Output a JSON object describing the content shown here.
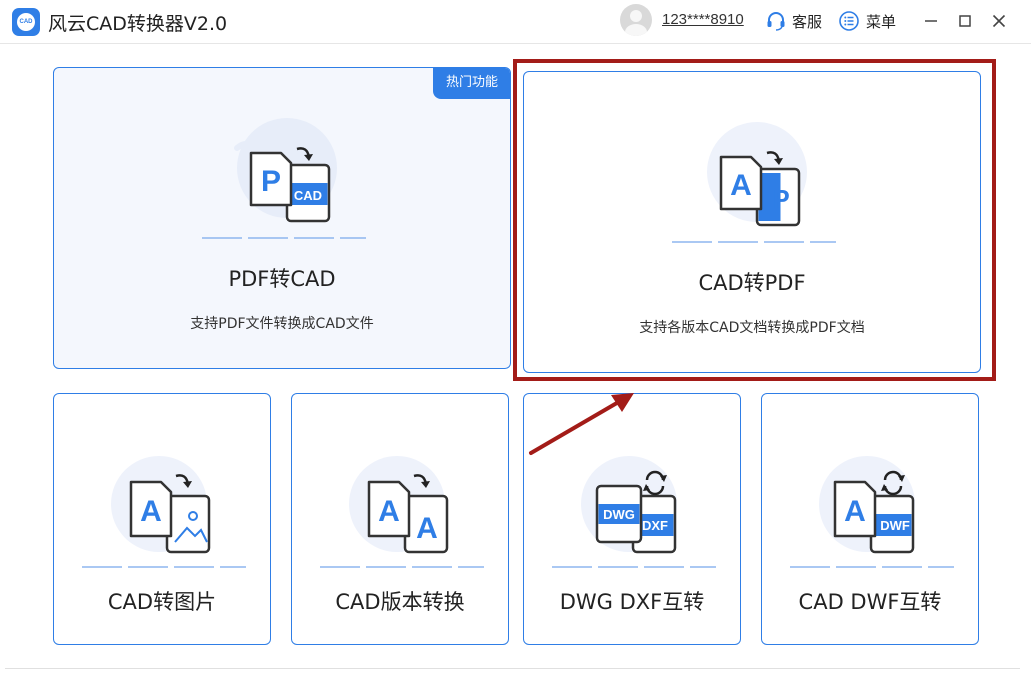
{
  "app": {
    "logo_text": "CAD",
    "title": "风云CAD转换器V2.0"
  },
  "header": {
    "account": "123****8910",
    "service_label": "客服",
    "menu_label": "菜单"
  },
  "colors": {
    "accent": "#2f7ee6",
    "highlight": "#a31c18",
    "card_bg": "#f4f7fd"
  },
  "cards": {
    "pdf_to_cad": {
      "badge": "热门功能",
      "icon_front": "P",
      "icon_back": "CAD",
      "title": "PDF转CAD",
      "desc": "支持PDF文件转换成CAD文件"
    },
    "cad_to_pdf": {
      "icon_front": "A",
      "icon_back": "P",
      "title": "CAD转PDF",
      "desc": "支持各版本CAD文档转换成PDF文档"
    },
    "cad_to_image": {
      "icon_front": "A",
      "icon_back": "image-icon",
      "title": "CAD转图片"
    },
    "cad_version": {
      "icon_front": "A",
      "icon_back": "A",
      "title": "CAD版本转换"
    },
    "dwg_dxf": {
      "icon_front": "DWG",
      "icon_back": "DXF",
      "title": "DWG DXF互转"
    },
    "cad_dwf": {
      "icon_front": "A",
      "icon_back": "DWF",
      "title": "CAD DWF互转"
    }
  }
}
